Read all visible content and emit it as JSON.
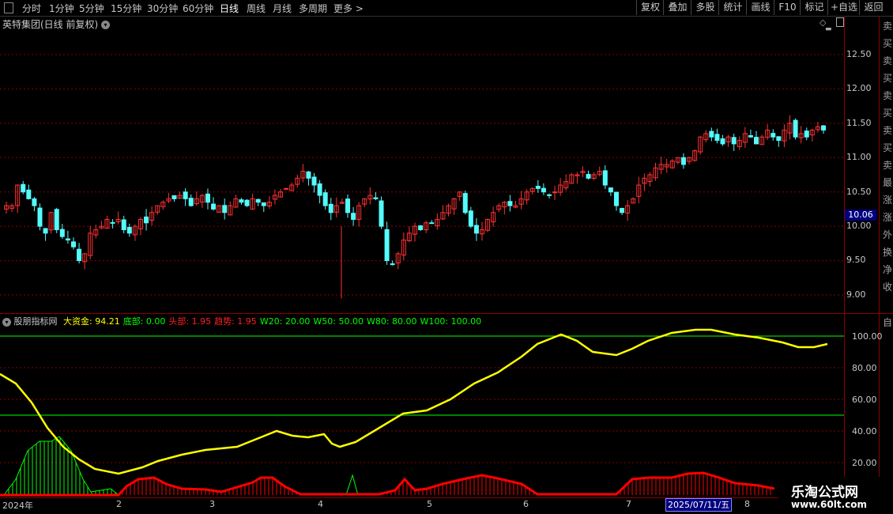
{
  "toolbar": {
    "periods": [
      "分时",
      "1分钟",
      "5分钟",
      "15分钟",
      "30分钟",
      "60分钟",
      "日线",
      "周线",
      "月线",
      "多周期",
      "更多 >"
    ],
    "selected": "日线",
    "right_buttons": [
      "复权",
      "叠加",
      "多股",
      "统计",
      "画线",
      "F10",
      "标记",
      "+自选",
      "返回"
    ]
  },
  "main": {
    "stock_title": "英特集团(日线 前复权)",
    "price_ticks": [
      "12.50",
      "12.00",
      "11.50",
      "11.00",
      "10.50",
      "10.00",
      "9.50",
      "9.00"
    ],
    "current_price": "10.06",
    "side_chars": [
      "卖",
      "买",
      "卖",
      "买",
      "卖",
      "买",
      "卖",
      "买",
      "卖",
      "最",
      "涨",
      "涨",
      "外",
      "换",
      "净",
      "收"
    ]
  },
  "indicator": {
    "name": "股朋指标网",
    "legend": [
      {
        "label": "大资金: ",
        "value": "94.21",
        "color": "#ffff00"
      },
      {
        "label": "底部: ",
        "value": "0.00",
        "color": "#00ff00"
      },
      {
        "label": "头部: ",
        "value": "1.95",
        "color": "#ff2020"
      },
      {
        "label": "趋势: ",
        "value": "1.95",
        "color": "#ff2020"
      },
      {
        "label": "W20: ",
        "value": "20.00",
        "color": "#00ff00"
      },
      {
        "label": "W50: ",
        "value": "50.00",
        "color": "#00ff00"
      },
      {
        "label": "W80: ",
        "value": "80.00",
        "color": "#00ff00"
      },
      {
        "label": "W100: ",
        "value": "100.00",
        "color": "#00ff00"
      }
    ],
    "ticks": [
      "100.00",
      "80.00",
      "60.00",
      "40.00",
      "20.00"
    ],
    "side_char": "自"
  },
  "date_axis": {
    "labels": [
      "2024年",
      "2",
      "3",
      "4",
      "5",
      "6",
      "7",
      "8"
    ],
    "cursor_date": "2025/07/11/五"
  },
  "watermark": {
    "name": "乐淘公式网",
    "url": "www.60lt.com"
  },
  "colors": {
    "up": "#ff3232",
    "down": "#54fcfc",
    "yellow": "#ffff00",
    "green": "#00ff00",
    "red": "#ff0000",
    "grid": "#8b0000"
  },
  "chart_data": {
    "type": "candlestick",
    "price_axis": {
      "ylim": [
        8.8,
        12.85
      ]
    },
    "indicator_axis": {
      "ylim": [
        0,
        110
      ]
    },
    "close_approx": [
      10.3,
      10.3,
      10.6,
      10.5,
      10.4,
      10.3,
      10.0,
      9.9,
      10.2,
      9.95,
      9.85,
      9.8,
      9.7,
      9.5,
      9.6,
      9.9,
      9.95,
      10.0,
      10.1,
      10.05,
      10.1,
      9.95,
      9.9,
      10.0,
      10.1,
      10.05,
      10.2,
      10.3,
      10.35,
      10.4,
      10.4,
      10.45,
      10.4,
      10.3,
      10.4,
      10.45,
      10.35,
      10.25,
      10.3,
      10.2,
      10.3,
      10.4,
      10.35,
      10.3,
      10.4,
      10.35,
      10.3,
      10.35,
      10.45,
      10.5,
      10.55,
      10.6,
      10.7,
      10.8,
      10.7,
      10.6,
      10.45,
      10.3,
      10.2,
      10.3,
      10.35,
      10.2,
      10.1,
      10.3,
      10.4,
      10.45,
      10.4,
      10.0,
      9.5,
      9.45,
      9.6,
      9.8,
      9.9,
      10.0,
      9.95,
      10.05,
      10.05,
      10.1,
      10.2,
      10.3,
      10.4,
      10.5,
      10.2,
      10.0,
      9.9,
      9.95,
      10.1,
      10.2,
      10.3,
      10.35,
      10.3,
      10.3,
      10.4,
      10.5,
      10.55,
      10.55,
      10.5,
      10.45,
      10.5,
      10.6,
      10.65,
      10.75,
      10.75,
      10.8,
      10.7,
      10.75,
      10.8,
      10.6,
      10.5,
      10.3,
      10.2,
      10.3,
      10.4,
      10.6,
      10.7,
      10.75,
      10.85,
      10.9,
      10.9,
      10.95,
      11.0,
      10.9,
      11.0,
      11.1,
      11.3,
      11.35,
      11.3,
      11.25,
      11.2,
      11.3,
      11.2,
      11.25,
      11.35,
      11.3,
      11.2,
      11.3,
      11.4,
      11.3,
      11.25,
      11.4,
      11.5,
      11.3,
      11.35,
      11.3,
      11.4,
      11.45,
      11.4
    ]
  }
}
